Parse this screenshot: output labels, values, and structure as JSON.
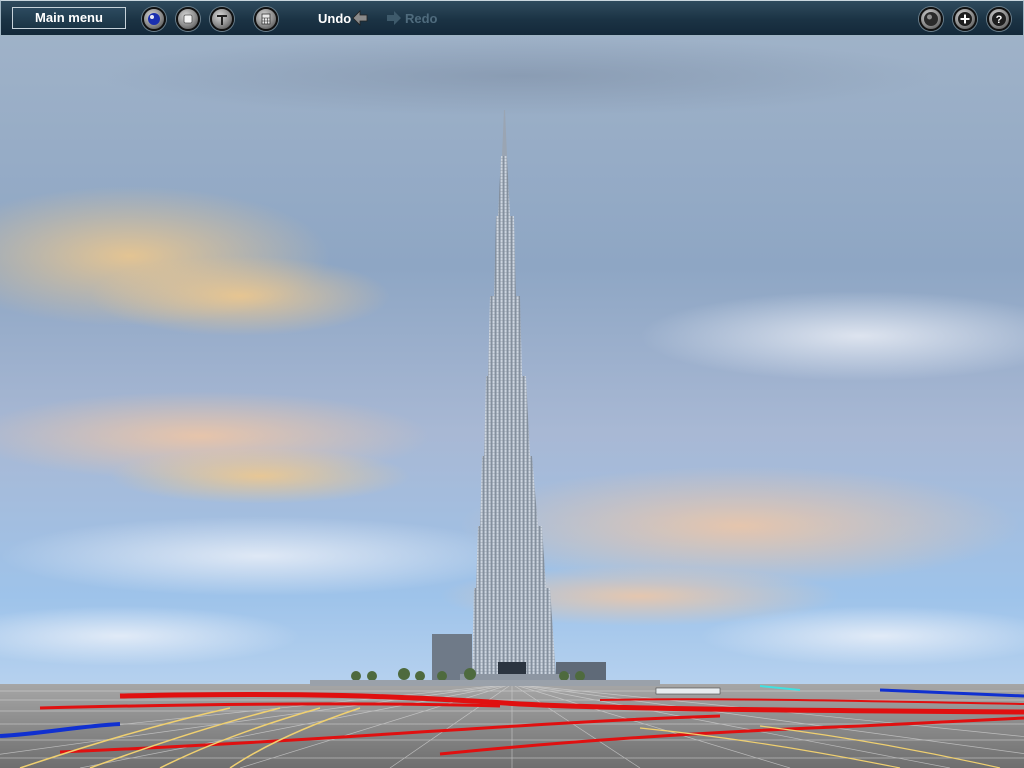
{
  "toolbar": {
    "main_menu_label": "Main menu",
    "undo_label": "Undo",
    "redo_label": "Redo",
    "left_buttons": [
      "sphere-icon",
      "stop-icon",
      "tool-icon",
      "calculator-icon"
    ],
    "right_buttons": [
      "globe-icon",
      "plus-icon",
      "help-icon"
    ]
  },
  "help_glyph": "?",
  "colors": {
    "toolbar_bg": "#1b3344",
    "toolbar_border": "#9fb4c2",
    "undo_text": "#ffffff",
    "redo_text_disabled": "#4f6b7d",
    "road_red": "#e01010",
    "road_blue": "#1030d0",
    "road_yellow": "#f0d070",
    "ground_grid": "#8a8a8a"
  },
  "scene": {
    "landmark": "skyscraper-tower",
    "sky": "partly-cloudy-dusk"
  }
}
